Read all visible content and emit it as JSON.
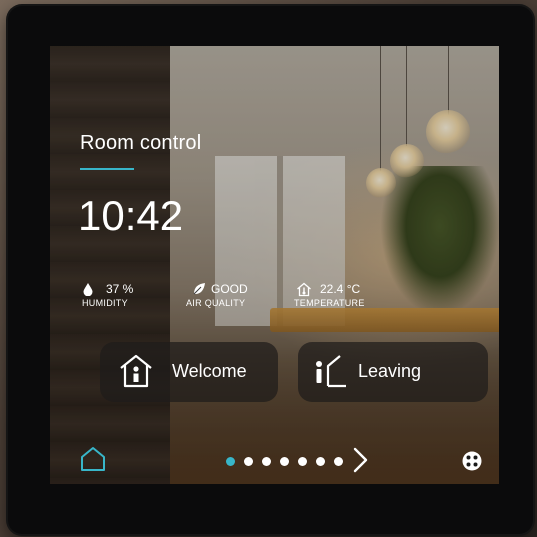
{
  "panel": {
    "title": "Room control",
    "time": "10:42"
  },
  "stats": [
    {
      "value": "37 %",
      "label": "HUMIDITY",
      "icon": "water-drop-icon"
    },
    {
      "value": "GOOD",
      "label": "AIR QUALITY",
      "icon": "leaf-icon"
    },
    {
      "value": "22.4 °C",
      "label": "TEMPERATURE",
      "icon": "home-thermometer-icon"
    }
  ],
  "scenes": [
    {
      "label": "Welcome",
      "icon": "home-person-icon"
    },
    {
      "label": "Leaving",
      "icon": "person-leaving-door-icon"
    }
  ],
  "navigation": {
    "home_icon": "home-icon",
    "page_count": 7,
    "active_page": 1,
    "next_icon": "chevron-right-icon",
    "more_icon": "grid-dots-icon"
  },
  "colors": {
    "accent": "#38b6c9",
    "text": "#ffffff",
    "bezel": "#0b0b0c"
  }
}
